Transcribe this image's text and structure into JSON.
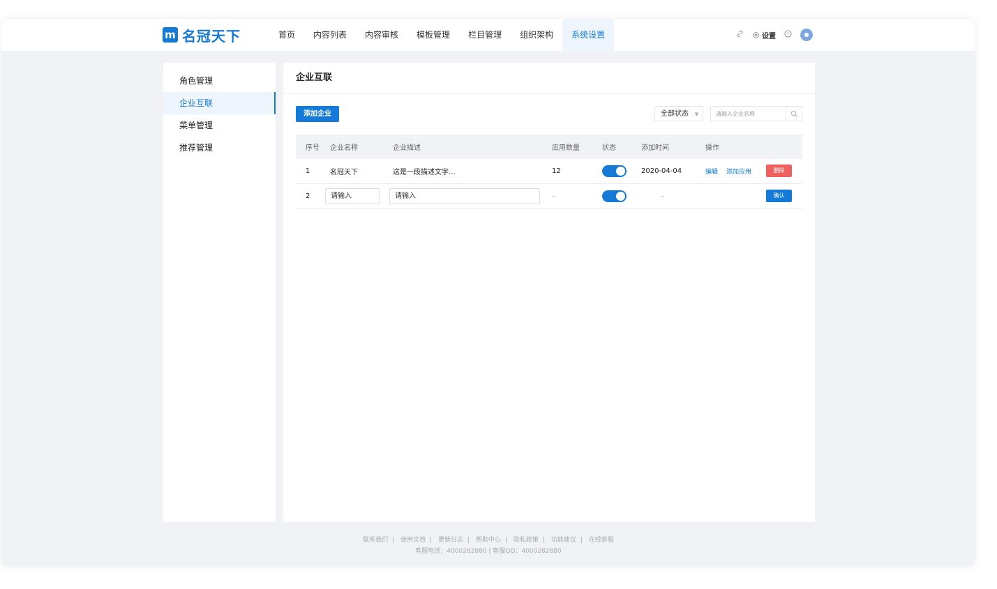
{
  "brand": {
    "logo_glyph": "m",
    "name": "名冠天下",
    "color": "#1479d7"
  },
  "nav": {
    "items": [
      "首页",
      "内容列表",
      "内容审核",
      "模板管理",
      "栏目管理",
      "组织架构",
      "系统设置"
    ],
    "active": "系统设置"
  },
  "toolbar": {
    "link_icon": "link-icon",
    "settings_label": "设置",
    "help_icon": "help-icon",
    "user_icon": "user-avatar"
  },
  "sidebar": {
    "items": [
      "角色管理",
      "企业互联",
      "菜单管理",
      "推荐管理"
    ],
    "active": "企业互联"
  },
  "main": {
    "title": "企业互联",
    "add_button": "添加企业",
    "status_filter": "全部状态",
    "search_placeholder": "请输入企业名称"
  },
  "table": {
    "headers": [
      "序号",
      "企业名称",
      "企业描述",
      "应用数量",
      "状态",
      "添加时间",
      "操作"
    ],
    "rows": [
      {
        "idx": "1",
        "name": "名冠天下",
        "desc": "这是一段描述文字...",
        "count": "12",
        "enabled": true,
        "time": "2020-04-04",
        "ops": [
          "编辑",
          "添加应用"
        ],
        "action": "删除"
      },
      {
        "idx": "2",
        "name_placeholder": "请输入",
        "desc_placeholder": "请输入",
        "count": "–",
        "enabled": true,
        "time": "–",
        "action": "确认"
      }
    ]
  },
  "footer": {
    "links": [
      "联系我们",
      "使用文档",
      "更新日志",
      "帮助中心",
      "隐私政策",
      "功能建议",
      "在线客服"
    ],
    "contact": "客服电话：4000282880 | 客服QQ：4000282880"
  }
}
